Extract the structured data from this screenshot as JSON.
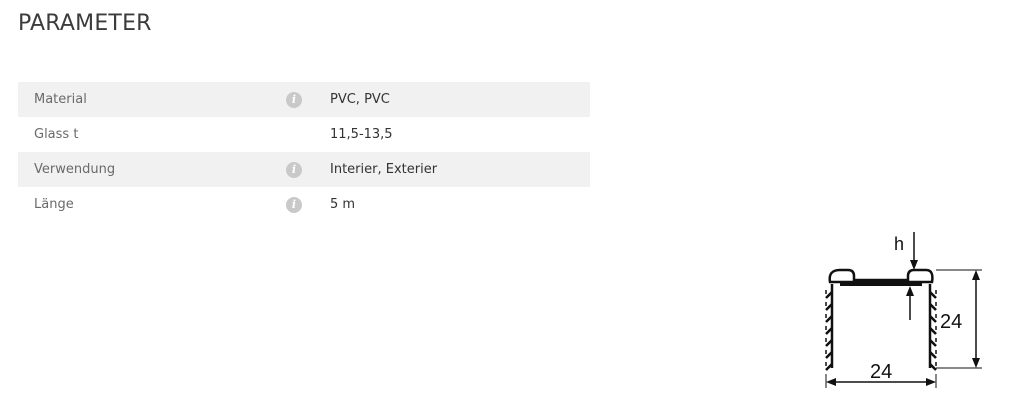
{
  "page": {
    "title": "PARAMETER"
  },
  "params": [
    {
      "label": "Material",
      "value": "PVC, PVC",
      "has_info": true,
      "info_icon": "info-icon"
    },
    {
      "label": "Glass t",
      "value": "11,5-13,5",
      "has_info": false
    },
    {
      "label": "Verwendung",
      "value": "Interier, Exterier",
      "has_info": true,
      "info_icon": "info-icon"
    },
    {
      "label": "Länge",
      "value": "5 m",
      "has_info": true,
      "info_icon": "info-icon"
    }
  ],
  "drawing": {
    "h_label": "h",
    "height_label": "24",
    "width_label": "24"
  },
  "colors": {
    "row_shade": "#f1f1f1",
    "info_icon": "#c9c9c9",
    "title": "#3c3c3c"
  }
}
